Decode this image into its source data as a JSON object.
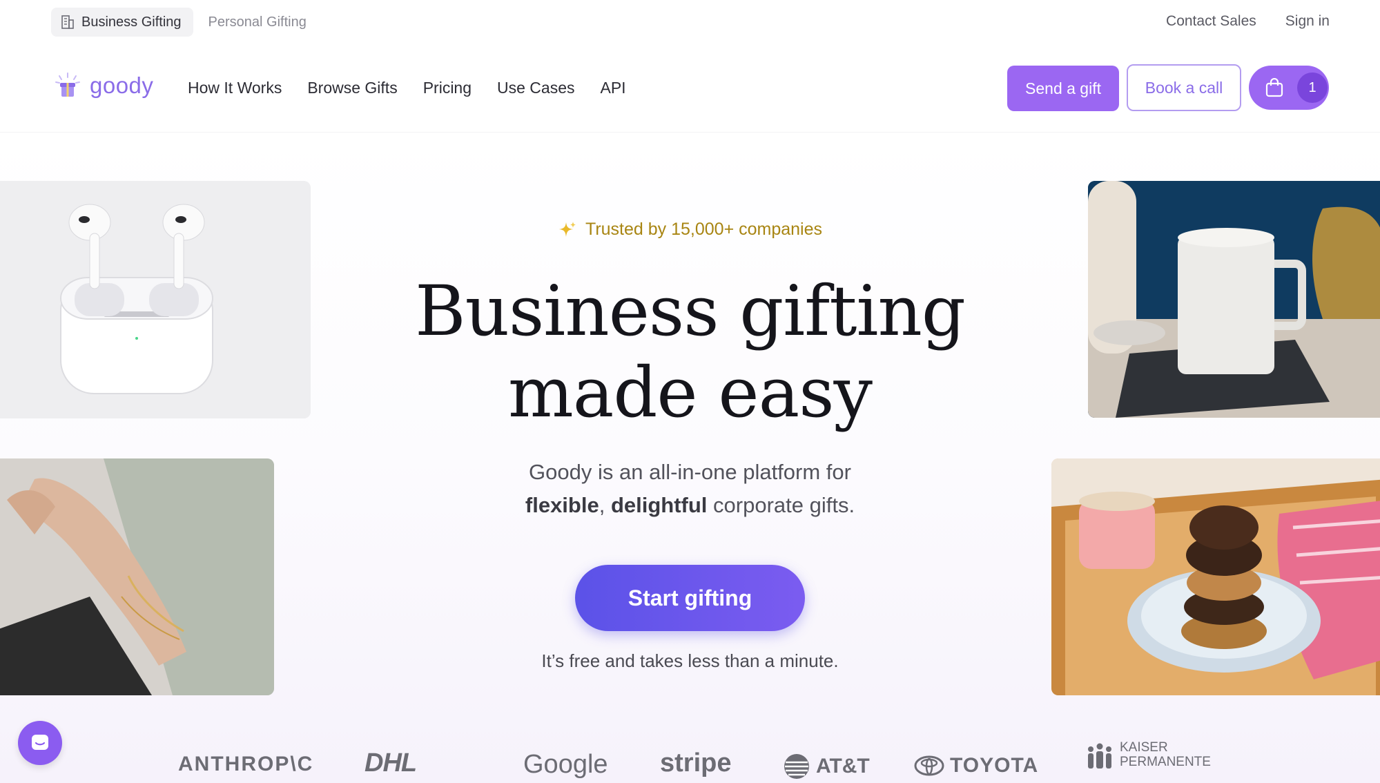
{
  "topbar": {
    "segments": [
      {
        "label": "Business Gifting",
        "active": true,
        "icon": "building-icon"
      },
      {
        "label": "Personal Gifting",
        "active": false
      }
    ],
    "links": [
      "Contact Sales",
      "Sign in"
    ]
  },
  "nav": {
    "logo_text": "goody",
    "links": [
      "How It Works",
      "Browse Gifts",
      "Pricing",
      "Use Cases",
      "API"
    ],
    "send_gift_label": "Send a gift",
    "book_call_label": "Book a call",
    "cart_count": "1"
  },
  "hero": {
    "trusted": "Trusted by 15,000+ companies",
    "headline_line1": "Business gifting",
    "headline_line2": "made easy",
    "sub_line1": "Goody is an all-in-one platform for",
    "sub_bold1": "flexible",
    "sub_sep": ", ",
    "sub_bold2": "delightful",
    "sub_rest": " corporate gifts.",
    "cta_label": "Start gifting",
    "cta_note": "It’s free and takes less than a minute."
  },
  "logos": [
    "ANTHROP\\C",
    "DHL",
    "Google",
    "stripe",
    "AT&T",
    "TOYOTA",
    "KAISER",
    "PERMANENTE"
  ],
  "colors": {
    "brand": "#9b67f2",
    "brand_dark": "#7a45dc",
    "cta_start": "#5b52e8",
    "trusted_gold": "#a88512"
  }
}
